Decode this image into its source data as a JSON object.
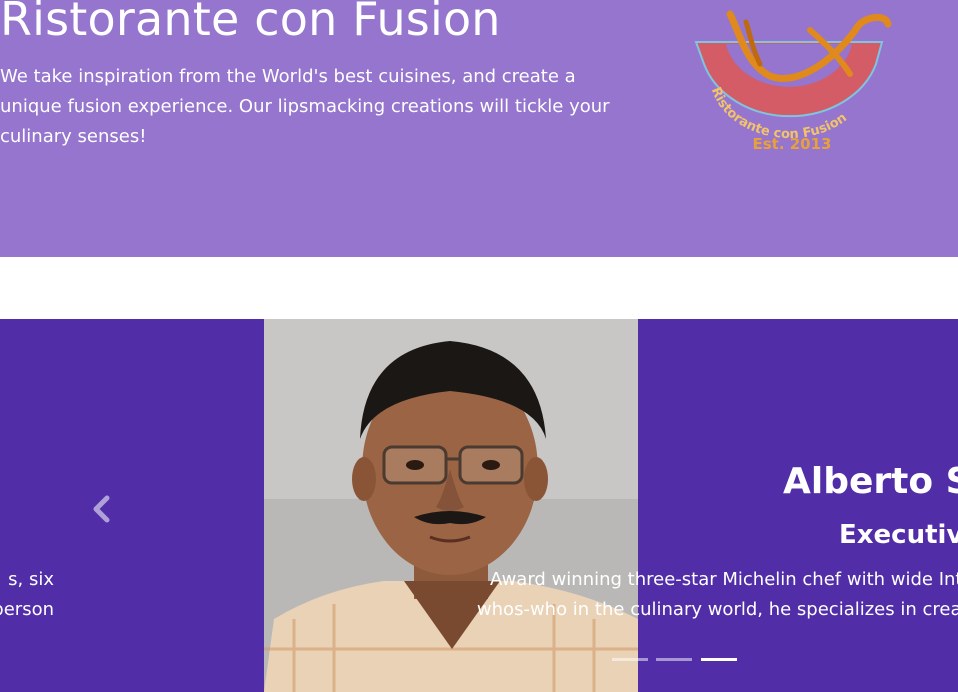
{
  "jumbotron": {
    "title": "Ristorante con Fusion",
    "description": "We take inspiration from the World's best cuisines, and create a unique fusion experience. Our lipsmacking creations will tickle your culinary senses!",
    "logo_text": "Ristorante con Fusion",
    "logo_est": "Est. 2013"
  },
  "carousel": {
    "prev_slide_line1": "s, six",
    "prev_slide_line2": "person",
    "prev_icon": "chevron-left-icon",
    "slide": {
      "name": "Alberto Sc",
      "role": "Executive",
      "desc_line1": "Award winning three-star Michelin chef with wide Inte",
      "desc_line2": "whos-who in the culinary world, he specializes in creati"
    },
    "indicators": [
      {
        "active": false
      },
      {
        "active": false
      },
      {
        "active": true
      }
    ]
  },
  "colors": {
    "jumbotron_bg": "#9575cd",
    "carousel_bg": "#512da8",
    "text": "#ffffff"
  }
}
